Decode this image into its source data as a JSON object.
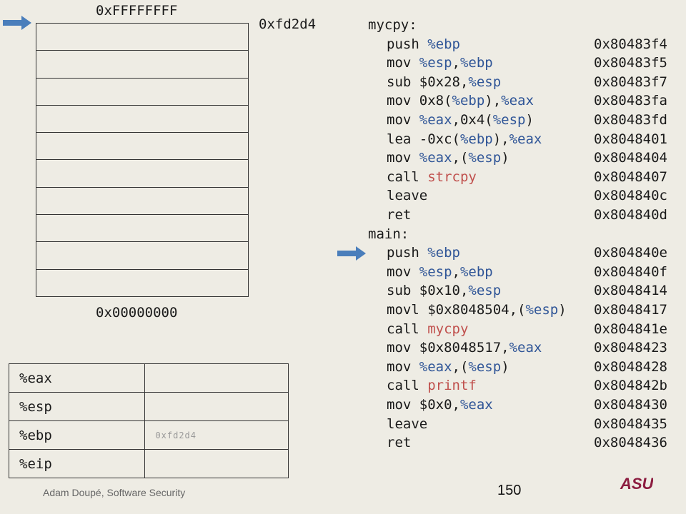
{
  "stack": {
    "top_label": "0xFFFFFFFF",
    "bottom_label": "0x00000000",
    "pointer_label": "0xfd2d4",
    "cell_count": 10
  },
  "registers": [
    {
      "name": "%eax",
      "value": ""
    },
    {
      "name": "%esp",
      "value": ""
    },
    {
      "name": "%ebp",
      "value": "0xfd2d4"
    },
    {
      "name": "%eip",
      "value": ""
    }
  ],
  "code": {
    "functions": [
      {
        "label": "mycpy",
        "lines": [
          {
            "tokens": [
              {
                "t": "push "
              },
              {
                "t": "%ebp",
                "k": "reg"
              }
            ],
            "addr": "0x80483f4"
          },
          {
            "tokens": [
              {
                "t": "mov "
              },
              {
                "t": "%esp",
                "k": "reg"
              },
              {
                "t": ","
              },
              {
                "t": "%ebp",
                "k": "reg"
              }
            ],
            "addr": "0x80483f5"
          },
          {
            "tokens": [
              {
                "t": "sub $0x28,"
              },
              {
                "t": "%esp",
                "k": "reg"
              }
            ],
            "addr": "0x80483f7"
          },
          {
            "tokens": [
              {
                "t": "mov 0x8("
              },
              {
                "t": "%ebp",
                "k": "reg"
              },
              {
                "t": "),"
              },
              {
                "t": "%eax",
                "k": "reg"
              }
            ],
            "addr": "0x80483fa"
          },
          {
            "tokens": [
              {
                "t": "mov "
              },
              {
                "t": "%eax",
                "k": "reg"
              },
              {
                "t": ",0x4("
              },
              {
                "t": "%esp",
                "k": "reg"
              },
              {
                "t": ")"
              }
            ],
            "addr": "0x80483fd"
          },
          {
            "tokens": [
              {
                "t": "lea -0xc("
              },
              {
                "t": "%ebp",
                "k": "reg"
              },
              {
                "t": "),"
              },
              {
                "t": "%eax",
                "k": "reg"
              }
            ],
            "addr": "0x8048401"
          },
          {
            "tokens": [
              {
                "t": "mov "
              },
              {
                "t": "%eax",
                "k": "reg"
              },
              {
                "t": ",("
              },
              {
                "t": "%esp",
                "k": "reg"
              },
              {
                "t": ")"
              }
            ],
            "addr": "0x8048404"
          },
          {
            "tokens": [
              {
                "t": "call "
              },
              {
                "t": "strcpy",
                "k": "fn"
              }
            ],
            "addr": "0x8048407"
          },
          {
            "tokens": [
              {
                "t": "leave"
              }
            ],
            "addr": "0x804840c"
          },
          {
            "tokens": [
              {
                "t": "ret"
              }
            ],
            "addr": "0x804840d"
          }
        ]
      },
      {
        "label": "main",
        "lines": [
          {
            "tokens": [
              {
                "t": "push "
              },
              {
                "t": "%ebp",
                "k": "reg"
              }
            ],
            "addr": "0x804840e"
          },
          {
            "tokens": [
              {
                "t": "mov "
              },
              {
                "t": "%esp",
                "k": "reg"
              },
              {
                "t": ","
              },
              {
                "t": "%ebp",
                "k": "reg"
              }
            ],
            "addr": "0x804840f"
          },
          {
            "tokens": [
              {
                "t": "sub $0x10,"
              },
              {
                "t": "%esp",
                "k": "reg"
              }
            ],
            "addr": "0x8048414"
          },
          {
            "tokens": [
              {
                "t": "movl $0x8048504,("
              },
              {
                "t": "%esp",
                "k": "reg"
              },
              {
                "t": ")"
              }
            ],
            "addr": "0x8048417"
          },
          {
            "tokens": [
              {
                "t": "call "
              },
              {
                "t": "mycpy",
                "k": "fn"
              }
            ],
            "addr": "0x804841e"
          },
          {
            "tokens": [
              {
                "t": "mov $0x8048517,"
              },
              {
                "t": "%eax",
                "k": "reg"
              }
            ],
            "addr": "0x8048423"
          },
          {
            "tokens": [
              {
                "t": "mov "
              },
              {
                "t": "%eax",
                "k": "reg"
              },
              {
                "t": ",("
              },
              {
                "t": "%esp",
                "k": "reg"
              },
              {
                "t": ")"
              }
            ],
            "addr": "0x8048428"
          },
          {
            "tokens": [
              {
                "t": "call "
              },
              {
                "t": "printf",
                "k": "fn"
              }
            ],
            "addr": "0x804842b"
          },
          {
            "tokens": [
              {
                "t": "mov $0x0,"
              },
              {
                "t": "%eax",
                "k": "reg"
              }
            ],
            "addr": "0x8048430"
          },
          {
            "tokens": [
              {
                "t": "leave"
              }
            ],
            "addr": "0x8048435"
          },
          {
            "tokens": [
              {
                "t": "ret"
              }
            ],
            "addr": "0x8048436"
          }
        ]
      }
    ],
    "current_instruction_addr": "0x804840e"
  },
  "footer": {
    "author": "Adam Doupé, Software Security",
    "page": "150",
    "logo_text": "ASU"
  },
  "colors": {
    "background": "#EEECE4",
    "register_blue": "#2F5597",
    "function_red": "#C0504D",
    "arrow_blue": "#4A7EBB",
    "logo_maroon": "#8C1D40"
  },
  "icons": {
    "stack_pointer": "arrow-right-icon",
    "instruction_pointer": "arrow-right-icon"
  }
}
